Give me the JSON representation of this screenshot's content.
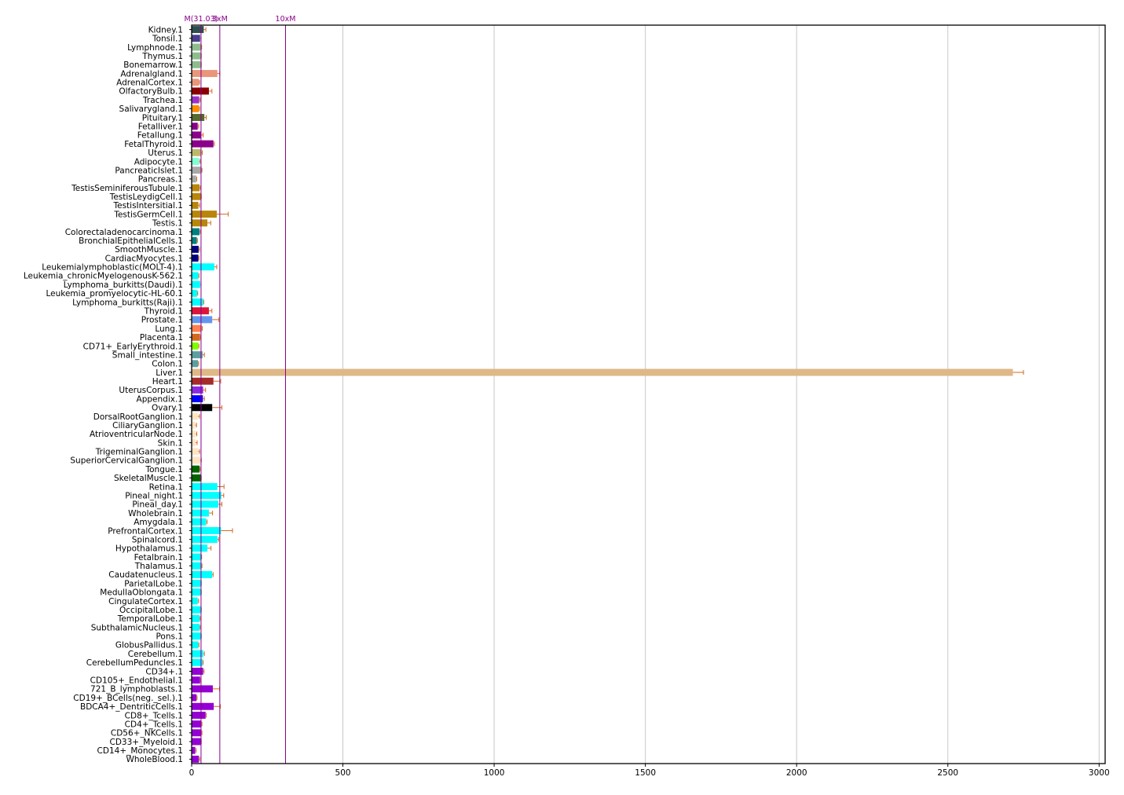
{
  "chart_data": {
    "type": "bar",
    "orientation": "horizontal",
    "title": "",
    "xlabel": "",
    "ylabel": "",
    "xlim": [
      0,
      3020
    ],
    "x_ticks": [
      0,
      500,
      1000,
      1500,
      2000,
      2500,
      3000
    ],
    "grid": "vertical",
    "reference_lines": [
      {
        "label": "M(31.03)",
        "value": 31.03
      },
      {
        "label": "3xM",
        "value": 93.1
      },
      {
        "label": "10xM",
        "value": 310.3
      }
    ],
    "bars": [
      {
        "category": "Kidney.1",
        "value": 40,
        "error": 7,
        "color": "#2f4f4f"
      },
      {
        "category": "Tonsil.1",
        "value": 28,
        "error": 3,
        "color": "#483d8b"
      },
      {
        "category": "Lymphnode.1",
        "value": 30,
        "error": 3,
        "color": "#8fbc8f"
      },
      {
        "category": "Thymus.1",
        "value": 30,
        "error": 2,
        "color": "#8fbc8f"
      },
      {
        "category": "Bonemarrow.1",
        "value": 30,
        "error": 2,
        "color": "#8fbc8f"
      },
      {
        "category": "Adrenalgland.1",
        "value": 85,
        "error": 8,
        "color": "#e9967a"
      },
      {
        "category": "AdrenalCortex.1",
        "value": 24,
        "error": 2,
        "color": "#e9967a"
      },
      {
        "category": "OlfactoryBulb.1",
        "value": 57,
        "error": 10,
        "color": "#8b0000"
      },
      {
        "category": "Trachea.1",
        "value": 25,
        "error": 3,
        "color": "#9932cc"
      },
      {
        "category": "Salivarygland.1",
        "value": 24,
        "error": 2,
        "color": "#ff8c00"
      },
      {
        "category": "Pituitary.1",
        "value": 42,
        "error": 6,
        "color": "#556b2f"
      },
      {
        "category": "Fetalliver.1",
        "value": 20,
        "error": 3,
        "color": "#8b008b"
      },
      {
        "category": "Fetallung.1",
        "value": 30,
        "error": 8,
        "color": "#8b008b"
      },
      {
        "category": "FetalThyroid.1",
        "value": 72,
        "error": 3,
        "color": "#8b008b"
      },
      {
        "category": "Uterus.1",
        "value": 32,
        "error": 3,
        "color": "#bdb76b"
      },
      {
        "category": "Adipocyte.1",
        "value": 25,
        "error": 3,
        "color": "#7fffd4"
      },
      {
        "category": "PancreaticIslet.1",
        "value": 32,
        "error": 2,
        "color": "#a9a9a9"
      },
      {
        "category": "Pancreas.1",
        "value": 15,
        "error": 2,
        "color": "#a9a9a9"
      },
      {
        "category": "TestisSeminiferousTubule.1",
        "value": 26,
        "error": 3,
        "color": "#b8860b"
      },
      {
        "category": "TestisLeydigCell.1",
        "value": 30,
        "error": 2,
        "color": "#b8860b"
      },
      {
        "category": "TestisIntersitial.1",
        "value": 22,
        "error": 4,
        "color": "#b8860b"
      },
      {
        "category": "TestisGermCell.1",
        "value": 83,
        "error": 38,
        "color": "#b8860b"
      },
      {
        "category": "Testis.1",
        "value": 52,
        "error": 11,
        "color": "#b8860b"
      },
      {
        "category": "Colorectaladenocarcinoma.1",
        "value": 26,
        "error": 3,
        "color": "#008080"
      },
      {
        "category": "BronchialEpithelialCells.1",
        "value": 17,
        "error": 2,
        "color": "#008080"
      },
      {
        "category": "SmoothMuscle.1",
        "value": 23,
        "error": 3,
        "color": "#000080"
      },
      {
        "category": "CardiacMyocytes.1",
        "value": 22,
        "error": 2,
        "color": "#000080"
      },
      {
        "category": "Leukemialymphoblastic(MOLT-4).1",
        "value": 75,
        "error": 8,
        "color": "#00ffff"
      },
      {
        "category": "Leukemia_chronicMyelogenousK-562.1",
        "value": 22,
        "error": 2,
        "color": "#00ffff"
      },
      {
        "category": "Lymphoma_burkitts(Daudi).1",
        "value": 28,
        "error": 3,
        "color": "#00ffff"
      },
      {
        "category": "Leukemia_promyelocytic-HL-60.1",
        "value": 18,
        "error": 2,
        "color": "#00ffff"
      },
      {
        "category": "Lymphoma_burkitts(Raji).1",
        "value": 38,
        "error": 2,
        "color": "#00ffff"
      },
      {
        "category": "Thyroid.1",
        "value": 57,
        "error": 10,
        "color": "#dc143c"
      },
      {
        "category": "Prostate.1",
        "value": 68,
        "error": 22,
        "color": "#6495ed"
      },
      {
        "category": "Lung.1",
        "value": 33,
        "error": 2,
        "color": "#ff7f50"
      },
      {
        "category": "Placenta.1",
        "value": 28,
        "error": 2,
        "color": "#d2691e"
      },
      {
        "category": "CD71+_EarlyErythroid.1",
        "value": 22,
        "error": 2,
        "color": "#7fff00"
      },
      {
        "category": "Small_intestine.1",
        "value": 36,
        "error": 6,
        "color": "#5f9ea0"
      },
      {
        "category": "Colon.1",
        "value": 21,
        "error": 2,
        "color": "#5f9ea0"
      },
      {
        "category": "Liver.1",
        "value": 2715,
        "error": 35,
        "color": "#deb887"
      },
      {
        "category": "Heart.1",
        "value": 72,
        "error": 24,
        "color": "#a52a2a"
      },
      {
        "category": "UterusCorpus.1",
        "value": 38,
        "error": 8,
        "color": "#8a2be2"
      },
      {
        "category": "Appendix.1",
        "value": 37,
        "error": 5,
        "color": "#0000ff"
      },
      {
        "category": "Ovary.1",
        "value": 68,
        "error": 32,
        "color": "#000000"
      },
      {
        "category": "DorsalRootGanglion.1",
        "value": 20,
        "error": 6,
        "color": "#ffe4c4"
      },
      {
        "category": "CiliaryGanglion.1",
        "value": 12,
        "error": 4,
        "color": "#ffe4c4"
      },
      {
        "category": "AtrioventricularNode.1",
        "value": 13,
        "error": 4,
        "color": "#ffe4c4"
      },
      {
        "category": "Skin.1",
        "value": 13,
        "error": 5,
        "color": "#ffe4c4"
      },
      {
        "category": "TrigeminalGanglion.1",
        "value": 22,
        "error": 4,
        "color": "#ffe4c4"
      },
      {
        "category": "SuperiorCervicalGanglion.1",
        "value": 28,
        "error": 4,
        "color": "#ffe4c4"
      },
      {
        "category": "Tongue.1",
        "value": 26,
        "error": 2,
        "color": "#006400"
      },
      {
        "category": "SkeletalMuscle.1",
        "value": 30,
        "error": 2,
        "color": "#006400"
      },
      {
        "category": "Retina.1",
        "value": 85,
        "error": 22,
        "color": "#00ffff"
      },
      {
        "category": "Pineal_night.1",
        "value": 98,
        "error": 8,
        "color": "#00ffff"
      },
      {
        "category": "Pineal_day.1",
        "value": 88,
        "error": 12,
        "color": "#00ffff"
      },
      {
        "category": "Wholebrain.1",
        "value": 57,
        "error": 12,
        "color": "#00ffff"
      },
      {
        "category": "Amygdala.1",
        "value": 48,
        "error": 3,
        "color": "#00ffff"
      },
      {
        "category": "PrefrontalCortex.1",
        "value": 97,
        "error": 38,
        "color": "#00ffff"
      },
      {
        "category": "Spinalcord.1",
        "value": 85,
        "error": 4,
        "color": "#00ffff"
      },
      {
        "category": "Hypothalamus.1",
        "value": 52,
        "error": 12,
        "color": "#00ffff"
      },
      {
        "category": "Fetalbrain.1",
        "value": 30,
        "error": 3,
        "color": "#00ffff"
      },
      {
        "category": "Thalamus.1",
        "value": 32,
        "error": 2,
        "color": "#00ffff"
      },
      {
        "category": "Caudatenucleus.1",
        "value": 68,
        "error": 3,
        "color": "#00ffff"
      },
      {
        "category": "ParietalLobe.1",
        "value": 30,
        "error": 2,
        "color": "#00ffff"
      },
      {
        "category": "MedullaOblongata.1",
        "value": 30,
        "error": 2,
        "color": "#00ffff"
      },
      {
        "category": "CingulateCortex.1",
        "value": 20,
        "error": 3,
        "color": "#00ffff"
      },
      {
        "category": "OccipitalLobe.1",
        "value": 30,
        "error": 2,
        "color": "#00ffff"
      },
      {
        "category": "TemporalLobe.1",
        "value": 26,
        "error": 2,
        "color": "#00ffff"
      },
      {
        "category": "SubthalamicNucleus.1",
        "value": 26,
        "error": 2,
        "color": "#00ffff"
      },
      {
        "category": "Pons.1",
        "value": 30,
        "error": 2,
        "color": "#00ffff"
      },
      {
        "category": "GlobusPallidus.1",
        "value": 22,
        "error": 2,
        "color": "#00ffff"
      },
      {
        "category": "Cerebellum.1",
        "value": 38,
        "error": 4,
        "color": "#00ffff"
      },
      {
        "category": "CerebellumPeduncles.1",
        "value": 36,
        "error": 2,
        "color": "#00ffff"
      },
      {
        "category": "CD34+.1",
        "value": 38,
        "error": 3,
        "color": "#9400d3"
      },
      {
        "category": "CD105+_Endothelial.1",
        "value": 28,
        "error": 2,
        "color": "#9400d3"
      },
      {
        "category": "721_B_lymphoblasts.1",
        "value": 70,
        "error": 22,
        "color": "#9400d3"
      },
      {
        "category": "CD19+_BCells(neg._sel.).1",
        "value": 16,
        "error": 2,
        "color": "#9400d3"
      },
      {
        "category": "BDCA4+_DentriticCells.1",
        "value": 73,
        "error": 22,
        "color": "#9400d3"
      },
      {
        "category": "CD8+_Tcells.1",
        "value": 46,
        "error": 2,
        "color": "#9400d3"
      },
      {
        "category": "CD4+_Tcells.1",
        "value": 32,
        "error": 2,
        "color": "#9400d3"
      },
      {
        "category": "CD56+_NKCells.1",
        "value": 32,
        "error": 2,
        "color": "#9400d3"
      },
      {
        "category": "CD33+_Myeloid.1",
        "value": 30,
        "error": 2,
        "color": "#9400d3"
      },
      {
        "category": "CD14+_Monocytes.1",
        "value": 12,
        "error": 3,
        "color": "#9400d3"
      },
      {
        "category": "WholeBlood.1",
        "value": 24,
        "error": 3,
        "color": "#9400d3"
      }
    ],
    "error_bar_color": "#d2691e",
    "ref_line_color": "#8b008b"
  }
}
